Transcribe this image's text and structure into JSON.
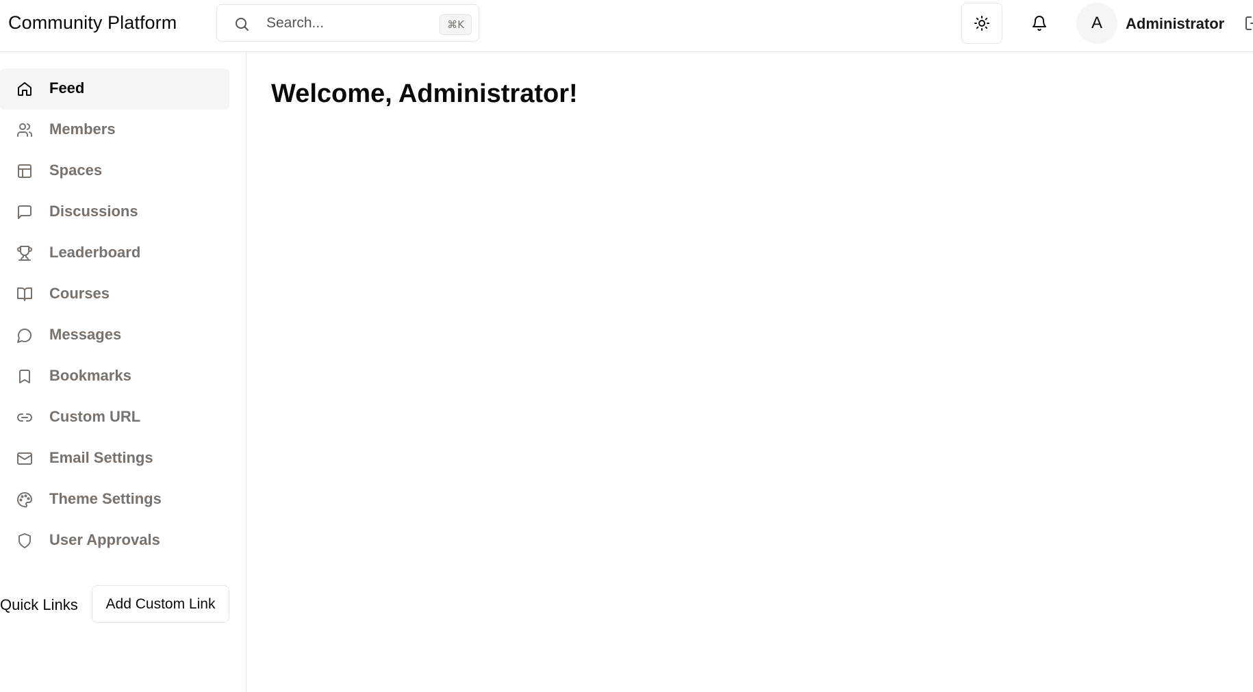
{
  "header": {
    "app_title": "Community Platform",
    "search": {
      "placeholder": "Search...",
      "shortcut": "⌘K"
    },
    "user": {
      "avatar_initial": "A",
      "name": "Administrator"
    }
  },
  "sidebar": {
    "items": [
      {
        "label": "Feed",
        "icon": "home-icon",
        "active": true
      },
      {
        "label": "Members",
        "icon": "users-icon"
      },
      {
        "label": "Spaces",
        "icon": "layout-icon"
      },
      {
        "label": "Discussions",
        "icon": "message-square-icon"
      },
      {
        "label": "Leaderboard",
        "icon": "trophy-icon"
      },
      {
        "label": "Courses",
        "icon": "book-open-icon"
      },
      {
        "label": "Messages",
        "icon": "message-circle-icon"
      },
      {
        "label": "Bookmarks",
        "icon": "bookmark-icon"
      },
      {
        "label": "Custom URL",
        "icon": "link-icon"
      },
      {
        "label": "Email Settings",
        "icon": "mail-icon"
      },
      {
        "label": "Theme Settings",
        "icon": "palette-icon"
      },
      {
        "label": "User Approvals",
        "icon": "shield-icon"
      }
    ],
    "quick_links": {
      "label": "Quick Links",
      "add_button": "Add Custom Link"
    }
  },
  "main": {
    "welcome": "Welcome, Administrator!"
  },
  "colors": {
    "active_bg": "#f5f5f4",
    "muted_text": "#78716c",
    "border": "#e7e5e4"
  }
}
